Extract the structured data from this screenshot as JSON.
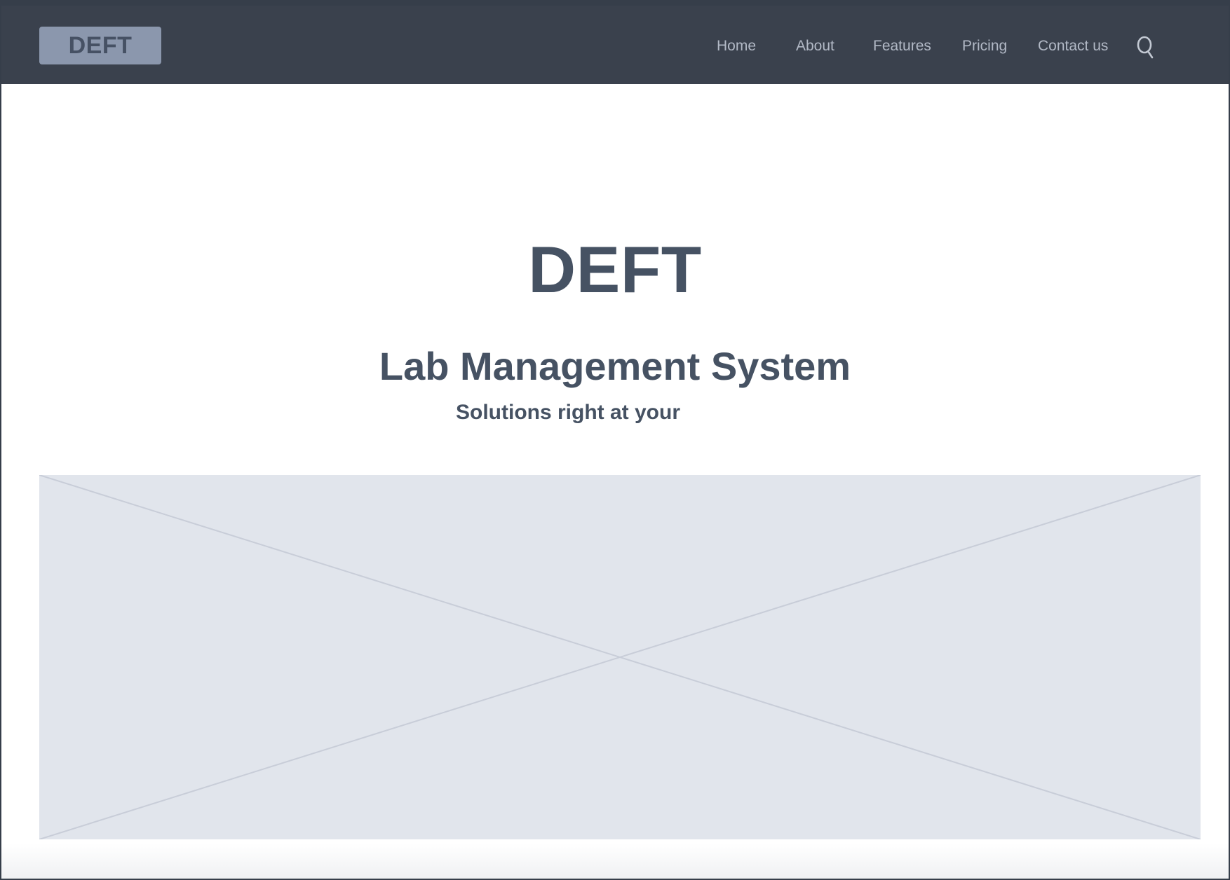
{
  "nav": {
    "logo_label": "DEFT",
    "links": [
      {
        "label": "Home"
      },
      {
        "label": "About"
      },
      {
        "label": "Features"
      },
      {
        "label": "Pricing"
      },
      {
        "label": "Contact us"
      }
    ],
    "search_icon": "search-icon"
  },
  "hero": {
    "title": "DEFT",
    "subtitle": "Lab Management System",
    "tagline": "Solutions right at your"
  },
  "media": {
    "placeholder_icon": "image-placeholder-cross"
  },
  "colors": {
    "navbar_bg": "#3a414d",
    "logo_bg": "#8b97ad",
    "heading_text": "#465263",
    "nav_text": "#b2b9c6",
    "placeholder_bg": "#e1e5ec"
  }
}
